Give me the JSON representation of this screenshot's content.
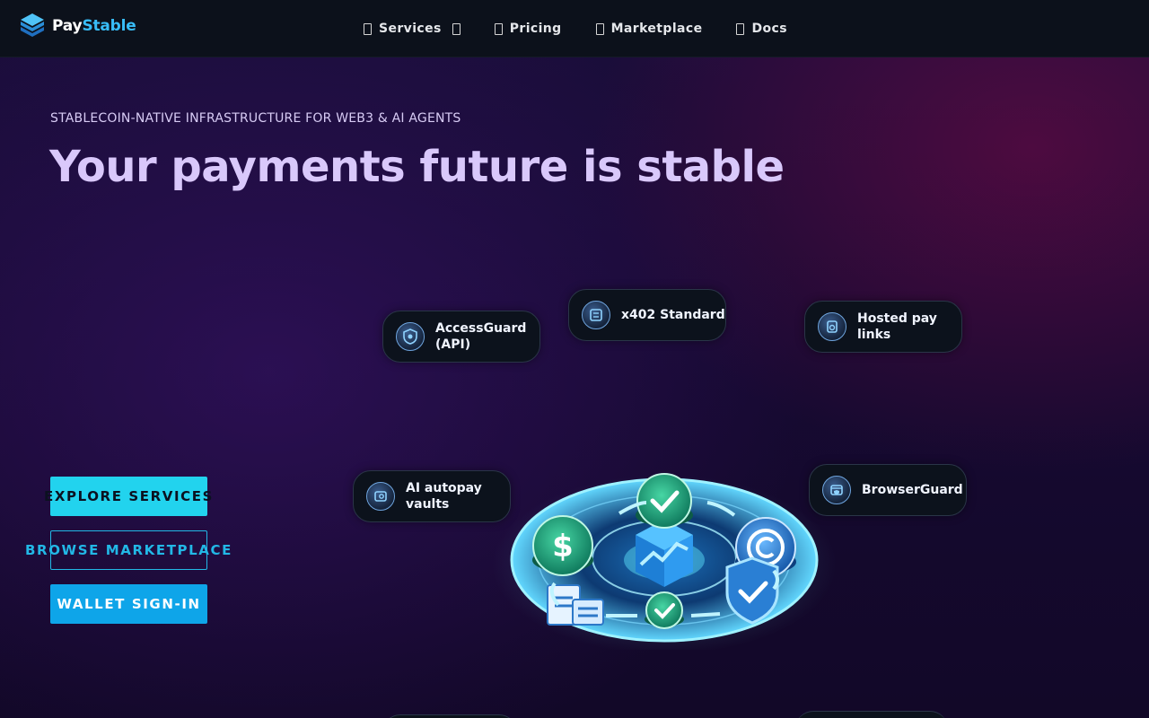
{
  "brand": {
    "name_part1": "Pay",
    "name_part2": "Stable",
    "logo_icon": "paystable-logo-icon"
  },
  "nav": {
    "items": [
      {
        "label": "Services",
        "icon": "services-icon",
        "has_dropdown": true
      },
      {
        "label": "Pricing",
        "icon": "pricing-icon"
      },
      {
        "label": "Marketplace",
        "icon": "marketplace-icon"
      },
      {
        "label": "Docs",
        "icon": "docs-icon"
      }
    ]
  },
  "hero": {
    "eyebrow": "STABLECOIN-NATIVE INFRASTRUCTURE FOR WEB3 & AI AGENTS",
    "headline": "Your payments future is stable",
    "buttons": {
      "explore": "EXPLORE SERVICES",
      "browse": "BROWSE MARKETPLACE",
      "wallet": "WALLET SIGN-IN"
    }
  },
  "features": [
    {
      "line1": "AccessGuard",
      "line2": "(API)",
      "icon": "shield-icon"
    },
    {
      "line1": "x402 Standard",
      "line2": "",
      "icon": "document-icon"
    },
    {
      "line1": "Hosted pay",
      "line2": "links",
      "icon": "link-icon"
    },
    {
      "line1": "AI autopay",
      "line2": "vaults",
      "icon": "vault-icon"
    },
    {
      "line1": "BrowserGuard",
      "line2": "",
      "icon": "browser-icon"
    }
  ],
  "colors": {
    "accent_cyan": "#22d3ee",
    "accent_blue": "#0ea5e9",
    "headline": "#d9c8fb",
    "nav_bg": "#0c111b"
  }
}
